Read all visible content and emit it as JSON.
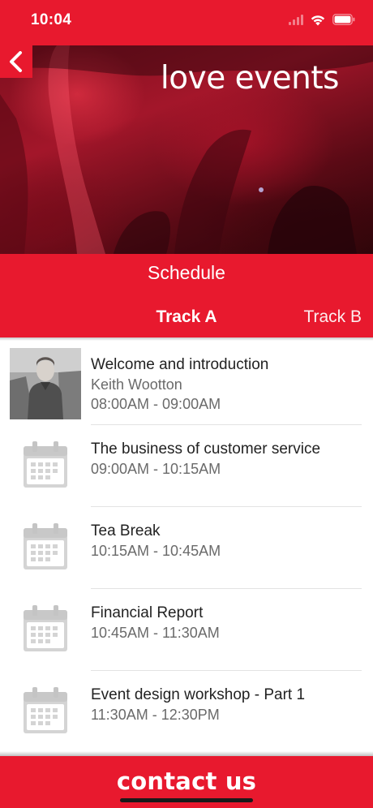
{
  "status_bar": {
    "time": "10:04"
  },
  "header": {
    "brand": "love events",
    "schedule_title": "Schedule"
  },
  "tabs": [
    {
      "label": "Track A",
      "selected": true
    },
    {
      "label": "Track B",
      "selected": false
    }
  ],
  "sessions": [
    {
      "title": "Welcome and introduction",
      "speaker": "Keith Wootton",
      "time": "08:00AM - 09:00AM",
      "icon": "speaker-photo"
    },
    {
      "title": "The business of customer service",
      "time": "09:00AM - 10:15AM",
      "icon": "calendar-icon"
    },
    {
      "title": "Tea Break",
      "time": "10:15AM - 10:45AM",
      "icon": "calendar-icon"
    },
    {
      "title": "Financial Report",
      "time": "10:45AM - 11:30AM",
      "icon": "calendar-icon"
    },
    {
      "title": "Event design workshop - Part 1",
      "time": "11:30AM - 12:30PM",
      "icon": "calendar-icon"
    }
  ],
  "footer": {
    "contact_label": "contact us"
  },
  "colors": {
    "brand_red": "#e8192e",
    "text_dark": "#222222",
    "text_muted": "#6a6a6a",
    "icon_gray": "#cfcfcf"
  }
}
